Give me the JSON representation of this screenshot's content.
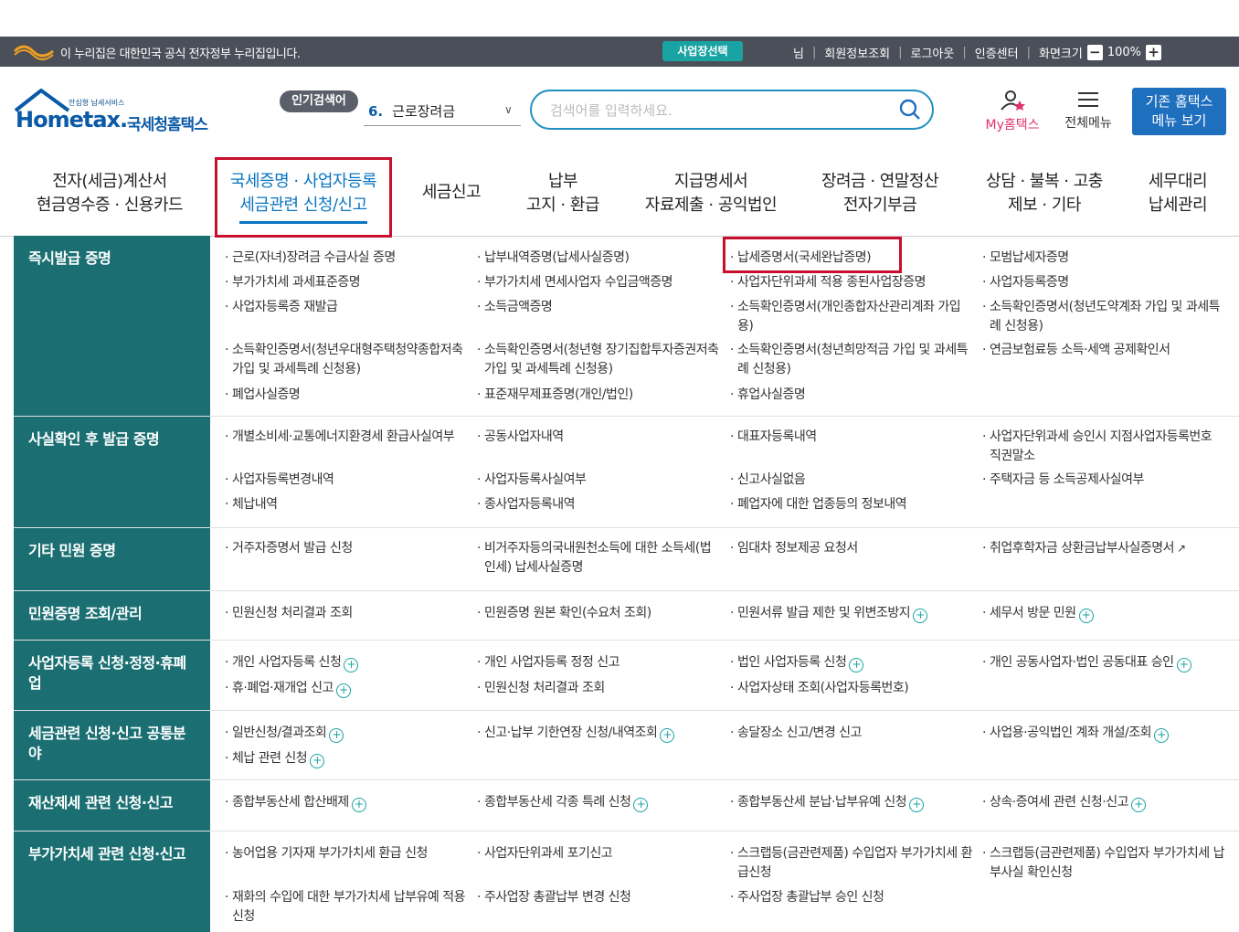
{
  "topbar": {
    "notice": "이 누리집은 대한민국 공식 전자정부 누리집입니다.",
    "biz_select": "사업장선택",
    "user_suffix": "님",
    "links": [
      "회원정보조회",
      "로그아웃",
      "인증센터",
      "화면크기"
    ],
    "zoom": "100%"
  },
  "header": {
    "brand_small": "안심형 납세서비스",
    "brand_en": "Hometax.",
    "brand_kr": "국세청홈택스",
    "popular_label": "인기검색어",
    "popular_rank": "6.",
    "popular_term": "근로장려금",
    "search_placeholder": "검색어를 입력하세요.",
    "myhome": "My홈택스",
    "allmenu": "전체메뉴",
    "oldhome_line1": "기존 홈택스",
    "oldhome_line2": "메뉴 보기"
  },
  "gnb": [
    {
      "line1": "전자(세금)계산서",
      "line2": "현금영수증 · 신용카드"
    },
    {
      "line1": "국세증명 · 사업자등록",
      "line2": "세금관련 신청/신고"
    },
    {
      "line1": "세금신고",
      "line2": ""
    },
    {
      "line1": "납부",
      "line2": "고지 · 환급"
    },
    {
      "line1": "지급명세서",
      "line2": "자료제출 · 공익법인"
    },
    {
      "line1": "장려금 · 연말정산",
      "line2": "전자기부금"
    },
    {
      "line1": "상담 · 불복 · 고충",
      "line2": "제보 · 기타"
    },
    {
      "line1": "세무대리",
      "line2": "납세관리"
    }
  ],
  "categories": [
    {
      "title": "즉시발급 증명",
      "items": [
        "근로(자녀)장려금 수급사실 증명",
        "납부내역증명(납세사실증명)",
        "납세증명서(국세완납증명)",
        "모범납세자증명",
        "부가가치세 과세표준증명",
        "부가가치세 면세사업자 수입금액증명",
        "사업자단위과세 적용 종된사업장증명",
        "사업자등록증명",
        "사업자등록증 재발급",
        "소득금액증명",
        "소득확인증명서(개인종합자산관리계좌 가입용)",
        "소득확인증명서(청년도약계좌 가입 및 과세특례 신청용)",
        "소득확인증명서(청년우대형주택청약종합저축 가입 및 과세특례 신청용)",
        "소득확인증명서(청년형 장기집합투자증권저축 가입 및 과세특례 신청용)",
        "소득확인증명서(청년희망적금 가입 및 과세특례 신청용)",
        "연금보험료등 소득·세액 공제확인서",
        "폐업사실증명",
        "표준재무제표증명(개인/법인)",
        "휴업사실증명"
      ]
    },
    {
      "title": "사실확인 후 발급 증명",
      "items": [
        "개별소비세·교통에너지환경세 환급사실여부",
        "공동사업자내역",
        "대표자등록내역",
        "사업자단위과세 승인시 지점사업자등록번호 직권말소",
        "사업자등록변경내역",
        "사업자등록사실여부",
        "신고사실없음",
        "주택자금 등 소득공제사실여부",
        "체납내역",
        "종사업자등록내역",
        "폐업자에 대한 업종등의 정보내역"
      ]
    },
    {
      "title": "기타 민원 증명",
      "items": [
        "거주자증명서 발급 신청",
        "비거주자등의국내원천소득에 대한 소득세(법인세) 납세사실증명",
        "임대차 정보제공 요청서",
        "취업후학자금 상환금납부사실증명서"
      ]
    },
    {
      "title": "민원증명 조회/관리",
      "items": [
        "민원신청 처리결과 조회",
        "민원증명 원본 확인(수요처 조회)",
        "민원서류 발급 제한 및 위변조방지",
        "세무서 방문 민원"
      ]
    },
    {
      "title": "사업자등록 신청·정정·휴폐업",
      "items": [
        "개인 사업자등록 신청",
        "개인 사업자등록 정정 신고",
        "법인 사업자등록 신청",
        "개인 공동사업자·법인 공동대표 승인",
        "휴·폐업·재개업 신고",
        "민원신청 처리결과 조회",
        "사업자상태 조회(사업자등록번호)"
      ]
    },
    {
      "title": "세금관련 신청·신고 공통분야",
      "items": [
        "일반신청/결과조회",
        "신고·납부 기한연장 신청/내역조회",
        "송달장소 신고/변경 신고",
        "사업용·공익법인 계좌 개설/조회",
        "체납 관련 신청"
      ]
    },
    {
      "title": "재산제세 관련 신청·신고",
      "items": [
        "종합부동산세 합산배제",
        "종합부동산세 각종 특례 신청",
        "종합부동산세 분납·납부유예 신청",
        "상속·증여세 관련 신청·신고"
      ]
    },
    {
      "title": "부가가치세 관련 신청·신고",
      "items": [
        "농어업용 기자재 부가가치세 환급 신청",
        "사업자단위과세 포기신고",
        "스크랩등(금관련제품) 수입업자 부가가치세 환급신청",
        "스크랩등(금관련제품) 수입업자 부가가치세 납부사실 확인신청",
        "재화의 수입에 대한 부가가치세 납부유예 적용 신청",
        "주사업장 총괄납부 변경 신청",
        "주사업장 총괄납부 승인 신청"
      ]
    }
  ],
  "colors": {
    "teal": "#1b6f72",
    "accent": "#0a75c2",
    "highlight": "#c8102e",
    "topbar": "#4b4f5a"
  }
}
